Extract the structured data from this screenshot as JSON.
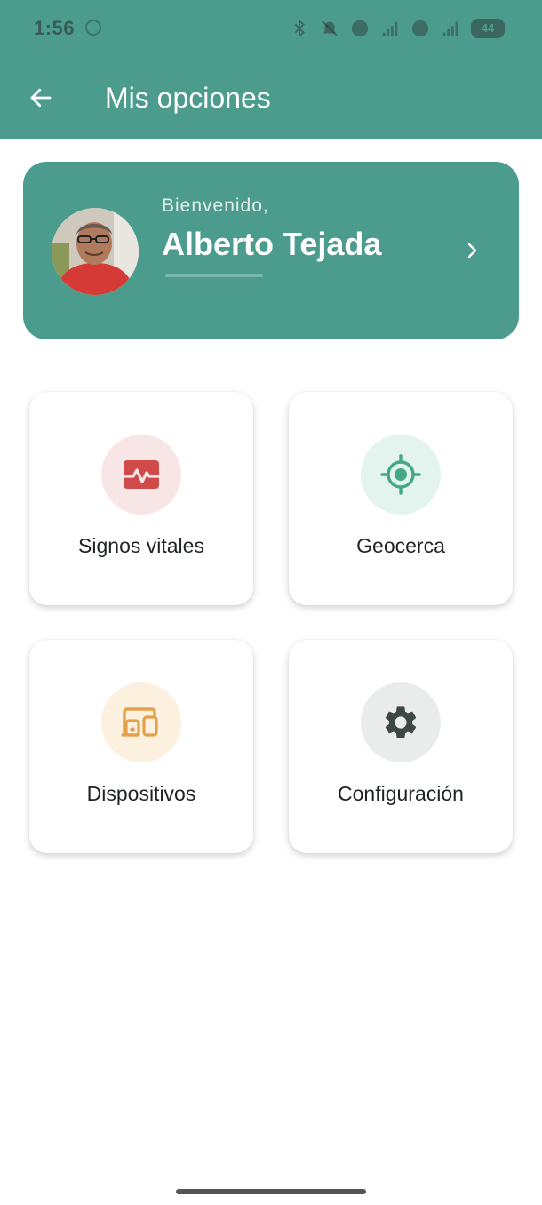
{
  "status_bar": {
    "time": "1:56",
    "battery": "44"
  },
  "app_bar": {
    "title": "Mis opciones",
    "back_icon": "arrow-left-icon"
  },
  "profile": {
    "greeting": "Bienvenido,",
    "name": "Alberto Tejada",
    "chevron_icon": "chevron-right-icon"
  },
  "options": [
    {
      "label": "Signos vitales",
      "icon": "heart-monitor-icon",
      "icon_color": "#d14a4a",
      "bg_color": "#f8e6e6"
    },
    {
      "label": "Geocerca",
      "icon": "gps-target-icon",
      "icon_color": "#45a884",
      "bg_color": "#e3f4ee"
    },
    {
      "label": "Dispositivos",
      "icon": "devices-icon",
      "icon_color": "#e3a04a",
      "bg_color": "#fcf0df"
    },
    {
      "label": "Configuración",
      "icon": "gear-icon",
      "icon_color": "#3d4744",
      "bg_color": "#eaeceb"
    }
  ],
  "colors": {
    "primary": "#4b9c8c",
    "text": "#1f2321"
  }
}
